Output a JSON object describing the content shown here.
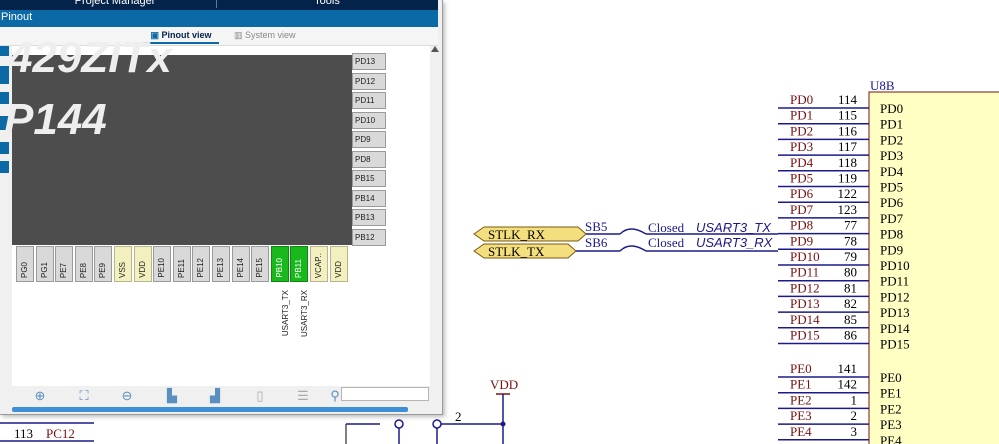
{
  "window": {
    "menu": [
      "Project Manager",
      "Tools"
    ],
    "title": "Pinout",
    "tabs": {
      "pinout": "Pinout view",
      "system": "System view"
    },
    "chip_line1": "429ZITx",
    "chip_line2": "P144",
    "right_pins": [
      "PD13",
      "PD12",
      "PD11",
      "PD10",
      "PD9",
      "PD8",
      "PB15",
      "PB14",
      "PB13",
      "PB12"
    ],
    "bottom_pins": [
      "PG0",
      "PG1",
      "PE7",
      "PE8",
      "PE9",
      "VSS",
      "VDD",
      "PE10",
      "PE11",
      "PE12",
      "PE13",
      "PE14",
      "PE15",
      "PB10",
      "PB11",
      "VCAP..",
      "VDD"
    ],
    "signals": {
      "pb10": "USART3_TX",
      "pb11": "USART3_RX"
    },
    "colors": {
      "titlebar": "#0b6aa6",
      "active_pin": "#19b91e",
      "power_pin": "#f3f0c0",
      "chip": "#4d4d4d"
    }
  },
  "schematic": {
    "part": "U8B",
    "pd_pins": [
      {
        "net": "PD0",
        "num": "114",
        "name": "PD0"
      },
      {
        "net": "PD1",
        "num": "115",
        "name": "PD1"
      },
      {
        "net": "PD2",
        "num": "116",
        "name": "PD2"
      },
      {
        "net": "PD3",
        "num": "117",
        "name": "PD3"
      },
      {
        "net": "PD4",
        "num": "118",
        "name": "PD4"
      },
      {
        "net": "PD5",
        "num": "119",
        "name": "PD5"
      },
      {
        "net": "PD6",
        "num": "122",
        "name": "PD6"
      },
      {
        "net": "PD7",
        "num": "123",
        "name": "PD7"
      },
      {
        "net": "PD8",
        "num": "77",
        "name": "PD8"
      },
      {
        "net": "PD9",
        "num": "78",
        "name": "PD9"
      },
      {
        "net": "PD10",
        "num": "79",
        "name": "PD10"
      },
      {
        "net": "PD11",
        "num": "80",
        "name": "PD11"
      },
      {
        "net": "PD12",
        "num": "81",
        "name": "PD12"
      },
      {
        "net": "PD13",
        "num": "82",
        "name": "PD13"
      },
      {
        "net": "PD14",
        "num": "85",
        "name": "PD14"
      },
      {
        "net": "PD15",
        "num": "86",
        "name": "PD15"
      }
    ],
    "pe_pins": [
      {
        "net": "PE0",
        "num": "141",
        "name": "PE0"
      },
      {
        "net": "PE1",
        "num": "142",
        "name": "PE1"
      },
      {
        "net": "PE2",
        "num": "1",
        "name": "PE2"
      },
      {
        "net": "PE3",
        "num": "2",
        "name": "PE3"
      },
      {
        "net": "PE4",
        "num": "3",
        "name": "PE4"
      }
    ],
    "ports": [
      "STLK_RX",
      "STLK_TX"
    ],
    "bridges": [
      {
        "ref": "SB5",
        "state": "Closed",
        "net": "USART3_TX"
      },
      {
        "ref": "SB6",
        "state": "Closed",
        "net": "USART3_RX"
      }
    ],
    "power_label": "VDD",
    "bottom_left": {
      "num": "113",
      "net": "PC12"
    },
    "node_label": "2",
    "colors": {
      "part_body": "#ffffc4",
      "wire": "#1a1a8c",
      "net_label": "#7a1010"
    }
  }
}
